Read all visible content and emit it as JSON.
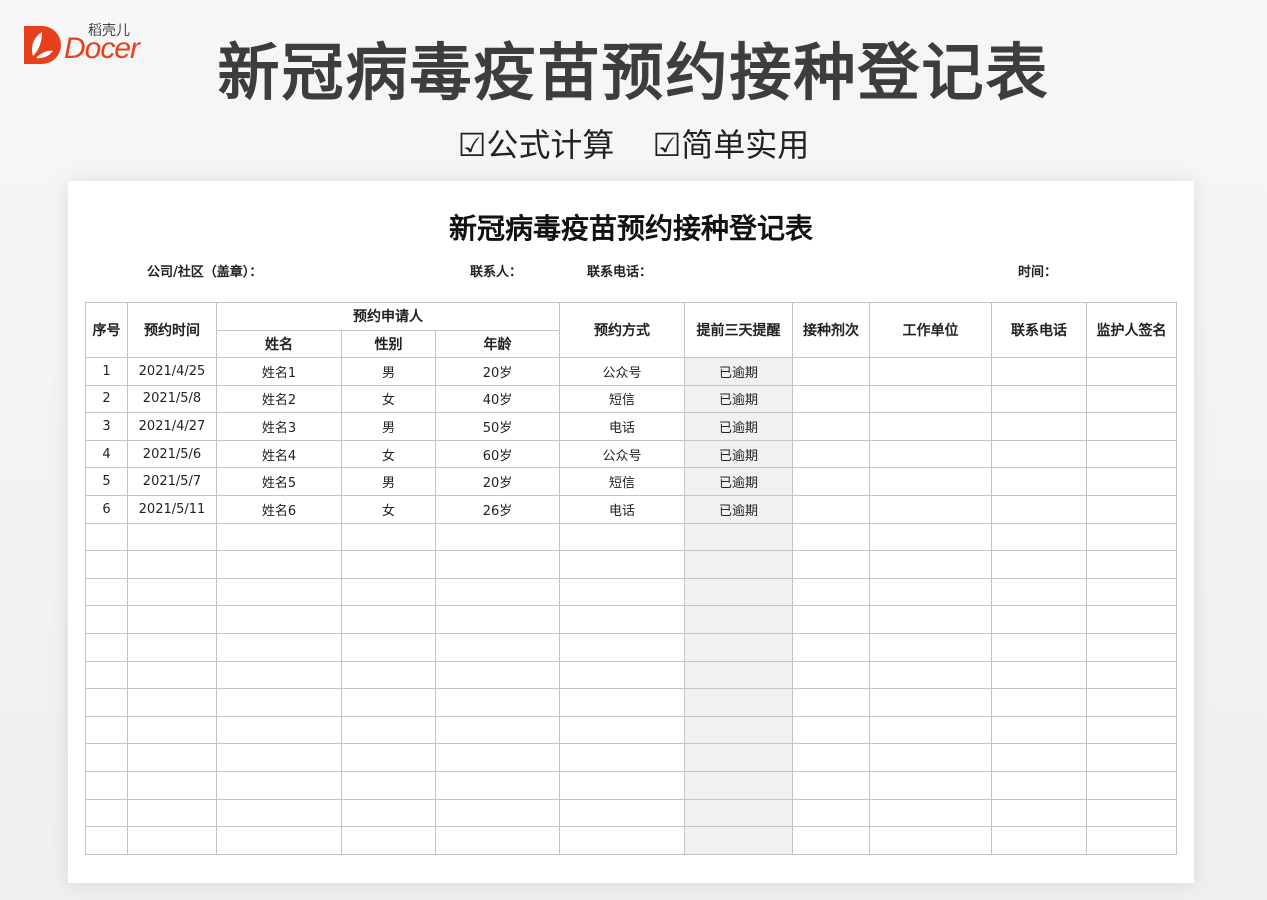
{
  "brand": {
    "logo_text": "Docer",
    "logo_cn": "稻壳儿",
    "colors": {
      "brand": "#e8401c",
      "title": "#3d3d3d",
      "border": "#c4c4c4",
      "reminder_bg": "#f1f1f1"
    }
  },
  "banner": {
    "title": "新冠病毒疫苗预约接种登记表",
    "features": [
      "☑公式计算",
      "☑简单实用"
    ]
  },
  "sheet": {
    "title": "新冠病毒疫苗预约接种登记表",
    "meta": {
      "company_label": "公司/社区（盖章）：",
      "contact_label": "联系人：",
      "phone_label": "联系电话：",
      "time_label": "时间："
    },
    "headers": {
      "seq": "序号",
      "appt_time": "预约时间",
      "applicant": "预约申请人",
      "name": "姓名",
      "gender": "性别",
      "age": "年龄",
      "method": "预约方式",
      "reminder": "提前三天提醒",
      "dose": "接种剂次",
      "workplace": "工作单位",
      "phone": "联系电话",
      "guardian": "监护人签名"
    },
    "rows": [
      {
        "seq": "1",
        "date": "2021/4/25",
        "name": "姓名1",
        "gender": "男",
        "age": "20岁",
        "method": "公众号",
        "reminder": "已逾期",
        "dose": "",
        "workplace": "",
        "phone": "",
        "guardian": ""
      },
      {
        "seq": "2",
        "date": "2021/5/8",
        "name": "姓名2",
        "gender": "女",
        "age": "40岁",
        "method": "短信",
        "reminder": "已逾期",
        "dose": "",
        "workplace": "",
        "phone": "",
        "guardian": ""
      },
      {
        "seq": "3",
        "date": "2021/4/27",
        "name": "姓名3",
        "gender": "男",
        "age": "50岁",
        "method": "电话",
        "reminder": "已逾期",
        "dose": "",
        "workplace": "",
        "phone": "",
        "guardian": ""
      },
      {
        "seq": "4",
        "date": "2021/5/6",
        "name": "姓名4",
        "gender": "女",
        "age": "60岁",
        "method": "公众号",
        "reminder": "已逾期",
        "dose": "",
        "workplace": "",
        "phone": "",
        "guardian": ""
      },
      {
        "seq": "5",
        "date": "2021/5/7",
        "name": "姓名5",
        "gender": "男",
        "age": "20岁",
        "method": "短信",
        "reminder": "已逾期",
        "dose": "",
        "workplace": "",
        "phone": "",
        "guardian": ""
      },
      {
        "seq": "6",
        "date": "2021/5/11",
        "name": "姓名6",
        "gender": "女",
        "age": "26岁",
        "method": "电话",
        "reminder": "已逾期",
        "dose": "",
        "workplace": "",
        "phone": "",
        "guardian": ""
      },
      {
        "seq": "",
        "date": "",
        "name": "",
        "gender": "",
        "age": "",
        "method": "",
        "reminder": "",
        "dose": "",
        "workplace": "",
        "phone": "",
        "guardian": ""
      },
      {
        "seq": "",
        "date": "",
        "name": "",
        "gender": "",
        "age": "",
        "method": "",
        "reminder": "",
        "dose": "",
        "workplace": "",
        "phone": "",
        "guardian": ""
      },
      {
        "seq": "",
        "date": "",
        "name": "",
        "gender": "",
        "age": "",
        "method": "",
        "reminder": "",
        "dose": "",
        "workplace": "",
        "phone": "",
        "guardian": ""
      },
      {
        "seq": "",
        "date": "",
        "name": "",
        "gender": "",
        "age": "",
        "method": "",
        "reminder": "",
        "dose": "",
        "workplace": "",
        "phone": "",
        "guardian": ""
      },
      {
        "seq": "",
        "date": "",
        "name": "",
        "gender": "",
        "age": "",
        "method": "",
        "reminder": "",
        "dose": "",
        "workplace": "",
        "phone": "",
        "guardian": ""
      },
      {
        "seq": "",
        "date": "",
        "name": "",
        "gender": "",
        "age": "",
        "method": "",
        "reminder": "",
        "dose": "",
        "workplace": "",
        "phone": "",
        "guardian": ""
      },
      {
        "seq": "",
        "date": "",
        "name": "",
        "gender": "",
        "age": "",
        "method": "",
        "reminder": "",
        "dose": "",
        "workplace": "",
        "phone": "",
        "guardian": ""
      },
      {
        "seq": "",
        "date": "",
        "name": "",
        "gender": "",
        "age": "",
        "method": "",
        "reminder": "",
        "dose": "",
        "workplace": "",
        "phone": "",
        "guardian": ""
      },
      {
        "seq": "",
        "date": "",
        "name": "",
        "gender": "",
        "age": "",
        "method": "",
        "reminder": "",
        "dose": "",
        "workplace": "",
        "phone": "",
        "guardian": ""
      },
      {
        "seq": "",
        "date": "",
        "name": "",
        "gender": "",
        "age": "",
        "method": "",
        "reminder": "",
        "dose": "",
        "workplace": "",
        "phone": "",
        "guardian": ""
      },
      {
        "seq": "",
        "date": "",
        "name": "",
        "gender": "",
        "age": "",
        "method": "",
        "reminder": "",
        "dose": "",
        "workplace": "",
        "phone": "",
        "guardian": ""
      },
      {
        "seq": "",
        "date": "",
        "name": "",
        "gender": "",
        "age": "",
        "method": "",
        "reminder": "",
        "dose": "",
        "workplace": "",
        "phone": "",
        "guardian": ""
      }
    ]
  }
}
